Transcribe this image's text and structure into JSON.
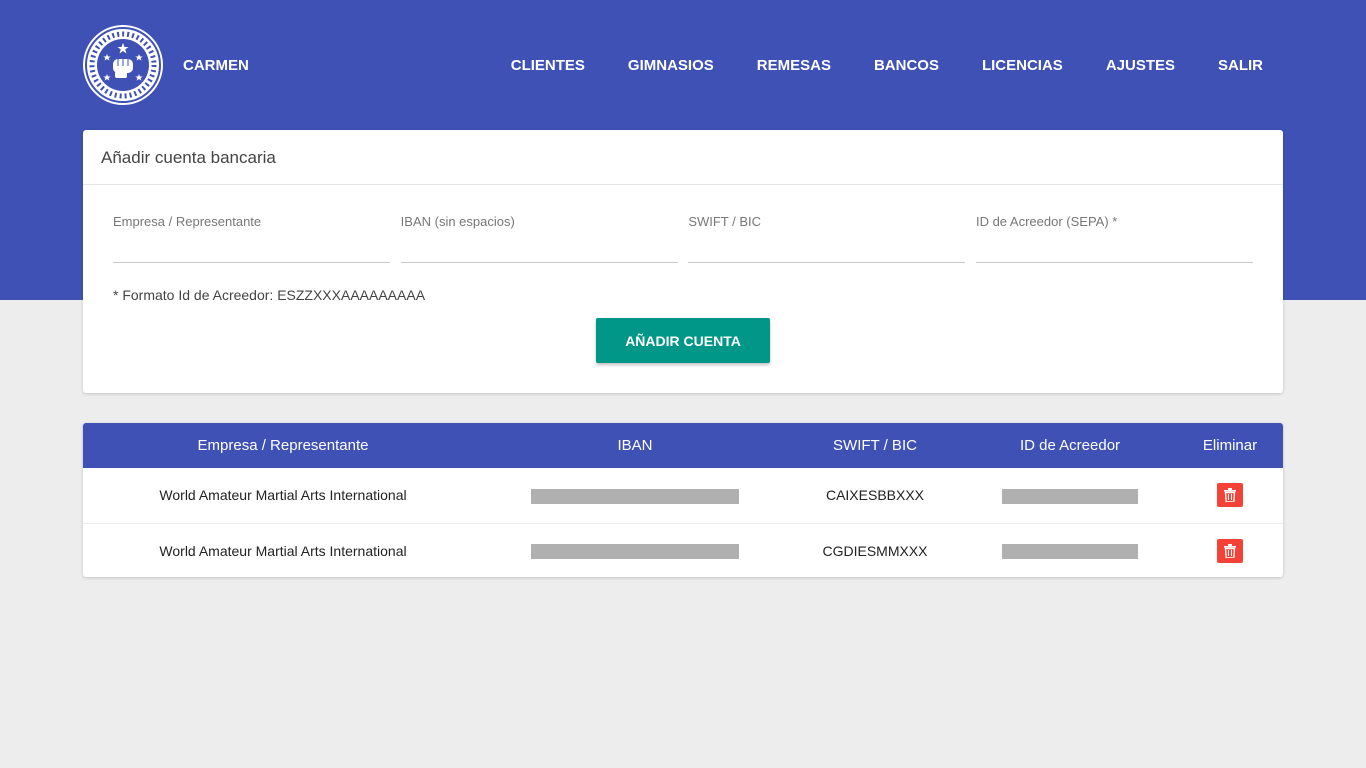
{
  "header": {
    "brand": "CARMEN",
    "logo_icon": "wmai-logo",
    "nav": [
      {
        "label": "CLIENTES"
      },
      {
        "label": "GIMNASIOS"
      },
      {
        "label": "REMESAS"
      },
      {
        "label": "BANCOS"
      },
      {
        "label": "LICENCIAS"
      },
      {
        "label": "AJUSTES"
      },
      {
        "label": "SALIR"
      }
    ]
  },
  "form": {
    "title": "Añadir cuenta bancaria",
    "fields": [
      {
        "label": "Empresa / Representante",
        "value": ""
      },
      {
        "label": "IBAN (sin espacios)",
        "value": ""
      },
      {
        "label": "SWIFT / BIC",
        "value": ""
      },
      {
        "label": "ID de Acreedor (SEPA) *",
        "value": ""
      }
    ],
    "note": "* Formato Id de Acreedor: ESZZXXXAAAAAAAAA",
    "submit_label": "AÑADIR CUENTA"
  },
  "table": {
    "headers": [
      "Empresa / Representante",
      "IBAN",
      "SWIFT / BIC",
      "ID de Acreedor",
      "Eliminar"
    ],
    "rows": [
      {
        "empresa": "World Amateur Martial Arts International",
        "iban": "redacted",
        "swift": "CAIXESBBXXX",
        "id_acreedor": "redacted",
        "delete_icon": "trash-icon"
      },
      {
        "empresa": "World Amateur Martial Arts International",
        "iban": "redacted",
        "swift": "CGDIESMMXXX",
        "id_acreedor": "redacted",
        "delete_icon": "trash-icon"
      }
    ]
  },
  "colors": {
    "primary": "#3f51b5",
    "accent": "#009688",
    "danger": "#f44336",
    "background": "#ededed"
  }
}
